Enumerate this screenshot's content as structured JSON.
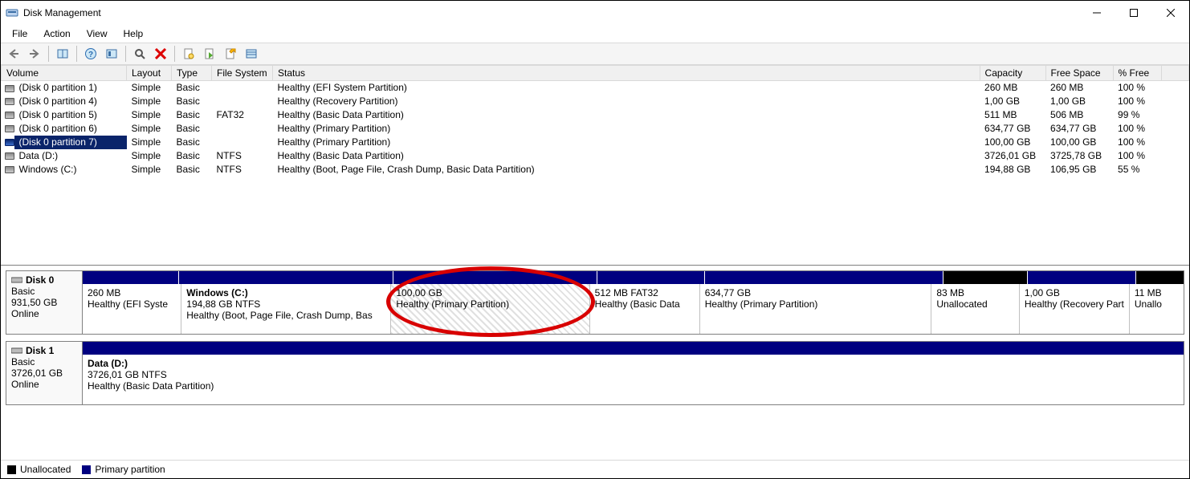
{
  "window": {
    "title": "Disk Management"
  },
  "menus": {
    "file": "File",
    "action": "Action",
    "view": "View",
    "help": "Help"
  },
  "columns": {
    "volume": "Volume",
    "layout": "Layout",
    "type": "Type",
    "filesystem": "File System",
    "status": "Status",
    "capacity": "Capacity",
    "freespace": "Free Space",
    "pctfree": "% Free"
  },
  "volumes": [
    {
      "name": "(Disk 0 partition 1)",
      "layout": "Simple",
      "type": "Basic",
      "fs": "",
      "status": "Healthy (EFI System Partition)",
      "capacity": "260 MB",
      "free": "260 MB",
      "pct": "100 %",
      "selected": false
    },
    {
      "name": "(Disk 0 partition 4)",
      "layout": "Simple",
      "type": "Basic",
      "fs": "",
      "status": "Healthy (Recovery Partition)",
      "capacity": "1,00 GB",
      "free": "1,00 GB",
      "pct": "100 %",
      "selected": false
    },
    {
      "name": "(Disk 0 partition 5)",
      "layout": "Simple",
      "type": "Basic",
      "fs": "FAT32",
      "status": "Healthy (Basic Data Partition)",
      "capacity": "511 MB",
      "free": "506 MB",
      "pct": "99 %",
      "selected": false
    },
    {
      "name": "(Disk 0 partition 6)",
      "layout": "Simple",
      "type": "Basic",
      "fs": "",
      "status": "Healthy (Primary Partition)",
      "capacity": "634,77 GB",
      "free": "634,77 GB",
      "pct": "100 %",
      "selected": false
    },
    {
      "name": "(Disk 0 partition 7)",
      "layout": "Simple",
      "type": "Basic",
      "fs": "",
      "status": "Healthy (Primary Partition)",
      "capacity": "100,00 GB",
      "free": "100,00 GB",
      "pct": "100 %",
      "selected": true
    },
    {
      "name": "Data (D:)",
      "layout": "Simple",
      "type": "Basic",
      "fs": "NTFS",
      "status": "Healthy (Basic Data Partition)",
      "capacity": "3726,01 GB",
      "free": "3725,78 GB",
      "pct": "100 %",
      "selected": false
    },
    {
      "name": "Windows (C:)",
      "layout": "Simple",
      "type": "Basic",
      "fs": "NTFS",
      "status": "Healthy (Boot, Page File, Crash Dump, Basic Data Partition)",
      "capacity": "194,88 GB",
      "free": "106,95 GB",
      "pct": "55 %",
      "selected": false
    }
  ],
  "disks": [
    {
      "name": "Disk 0",
      "type": "Basic",
      "size": "931,50 GB",
      "state": "Online",
      "parts": [
        {
          "title": "",
          "line2": "260 MB",
          "line3": "Healthy (EFI Syste",
          "flex": 8,
          "kind": "primary",
          "hatched": false
        },
        {
          "title": "Windows  (C:)",
          "line2": "194,88 GB NTFS",
          "line3": "Healthy (Boot, Page File, Crash Dump, Bas",
          "flex": 18,
          "kind": "primary",
          "hatched": false
        },
        {
          "title": "",
          "line2": "100,00 GB",
          "line3": "Healthy (Primary Partition)",
          "flex": 17,
          "kind": "primary",
          "hatched": true,
          "annotation": true
        },
        {
          "title": "",
          "line2": "512 MB FAT32",
          "line3": "Healthy (Basic Data",
          "flex": 9,
          "kind": "primary",
          "hatched": false
        },
        {
          "title": "",
          "line2": "634,77 GB",
          "line3": "Healthy (Primary Partition)",
          "flex": 20,
          "kind": "primary",
          "hatched": false
        },
        {
          "title": "",
          "line2": "83 MB",
          "line3": "Unallocated",
          "flex": 7,
          "kind": "unalloc",
          "hatched": false
        },
        {
          "title": "",
          "line2": "1,00 GB",
          "line3": "Healthy (Recovery Part",
          "flex": 9,
          "kind": "primary",
          "hatched": false
        },
        {
          "title": "",
          "line2": "11 MB",
          "line3": "Unallo",
          "flex": 4,
          "kind": "unalloc",
          "hatched": false
        }
      ]
    },
    {
      "name": "Disk 1",
      "type": "Basic",
      "size": "3726,01 GB",
      "state": "Online",
      "parts": [
        {
          "title": "Data  (D:)",
          "line2": "3726,01 GB NTFS",
          "line3": "Healthy (Basic Data Partition)",
          "flex": 1,
          "kind": "primary",
          "hatched": false
        }
      ]
    }
  ],
  "legend": {
    "unallocated": "Unallocated",
    "primary": "Primary partition"
  }
}
